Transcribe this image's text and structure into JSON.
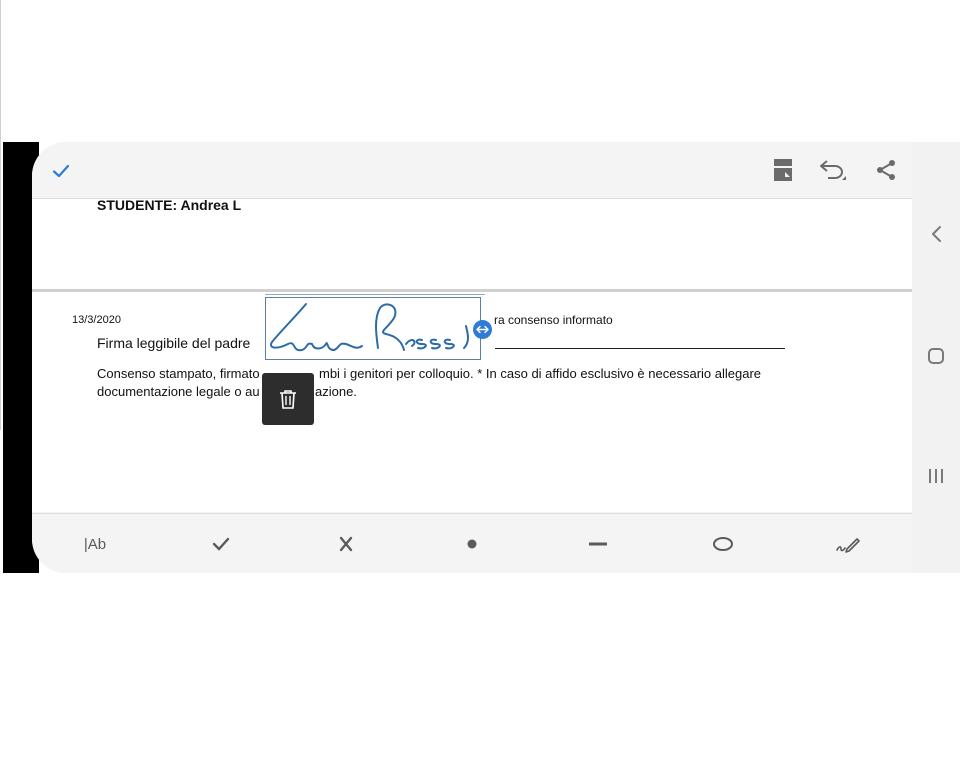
{
  "toolbar": {
    "done_icon": "check-icon",
    "page_icon": "document-icon",
    "undo_icon": "undo-icon",
    "share_icon": "share-icon"
  },
  "page1": {
    "student_label": "STUDENTE: Andrea L"
  },
  "page2": {
    "date": "13/3/2020",
    "consent_partial": "ra consenso informato",
    "father_signature_label": "Firma leggibile del padre",
    "note_line1_a": "Consenso stampato, firmato",
    "note_line1_b": "mbi i genitori per colloquio. * In caso di affido esclusivo è necessario allegare",
    "note_line2_a": "documentazione legale o au",
    "note_line2_b": "azione.",
    "signature_text": "Luca Rossi"
  },
  "bottom_tools": {
    "text_label": "|Ab",
    "items": [
      "text-tool",
      "check-tool",
      "cross-tool",
      "dot-tool",
      "line-tool",
      "ellipse-tool",
      "sign-tool"
    ]
  },
  "colors": {
    "accent": "#2f7bd6",
    "signature": "#2b6ca8",
    "toolbar_bg": "#f4f4f4"
  }
}
